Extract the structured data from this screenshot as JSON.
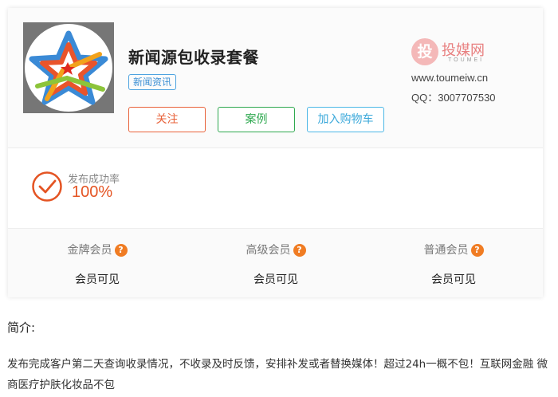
{
  "package": {
    "title": "新闻源包收录套餐",
    "tag": "新闻资讯"
  },
  "actions": {
    "follow": "关注",
    "case": "案例",
    "cart": "加入购物车"
  },
  "brand": {
    "logo_char": "投",
    "name": "投媒网",
    "sub": "TOUMEI",
    "site": "www.toumeiw.cn",
    "qq": "QQ：3007707530"
  },
  "stats": {
    "success_label": "发布成功率",
    "success_value": "100%"
  },
  "tiers": [
    {
      "name": "金牌会员",
      "help": "?",
      "value": "会员可见"
    },
    {
      "name": "高级会员",
      "help": "?",
      "value": "会员可见"
    },
    {
      "name": "普通会员",
      "help": "?",
      "value": "会员可见"
    }
  ],
  "intro": {
    "title": "简介:",
    "text": "发布完成客户第二天查询收录情况，不收录及时反馈，安排补发或者替换媒体！超过24h一概不包！互联网金融 微商医疗护肤化妆品不包"
  },
  "colors": {
    "accent_orange": "#e45423",
    "help_orange": "#f07c23",
    "follow_red": "#e8623a",
    "case_green": "#2ea84f",
    "cart_blue": "#4cb7e6",
    "tag_blue": "#4da3e0"
  },
  "icons": {
    "success": "check-circle-icon",
    "help": "question-circle-icon",
    "thumb": "star-logo-icon"
  }
}
